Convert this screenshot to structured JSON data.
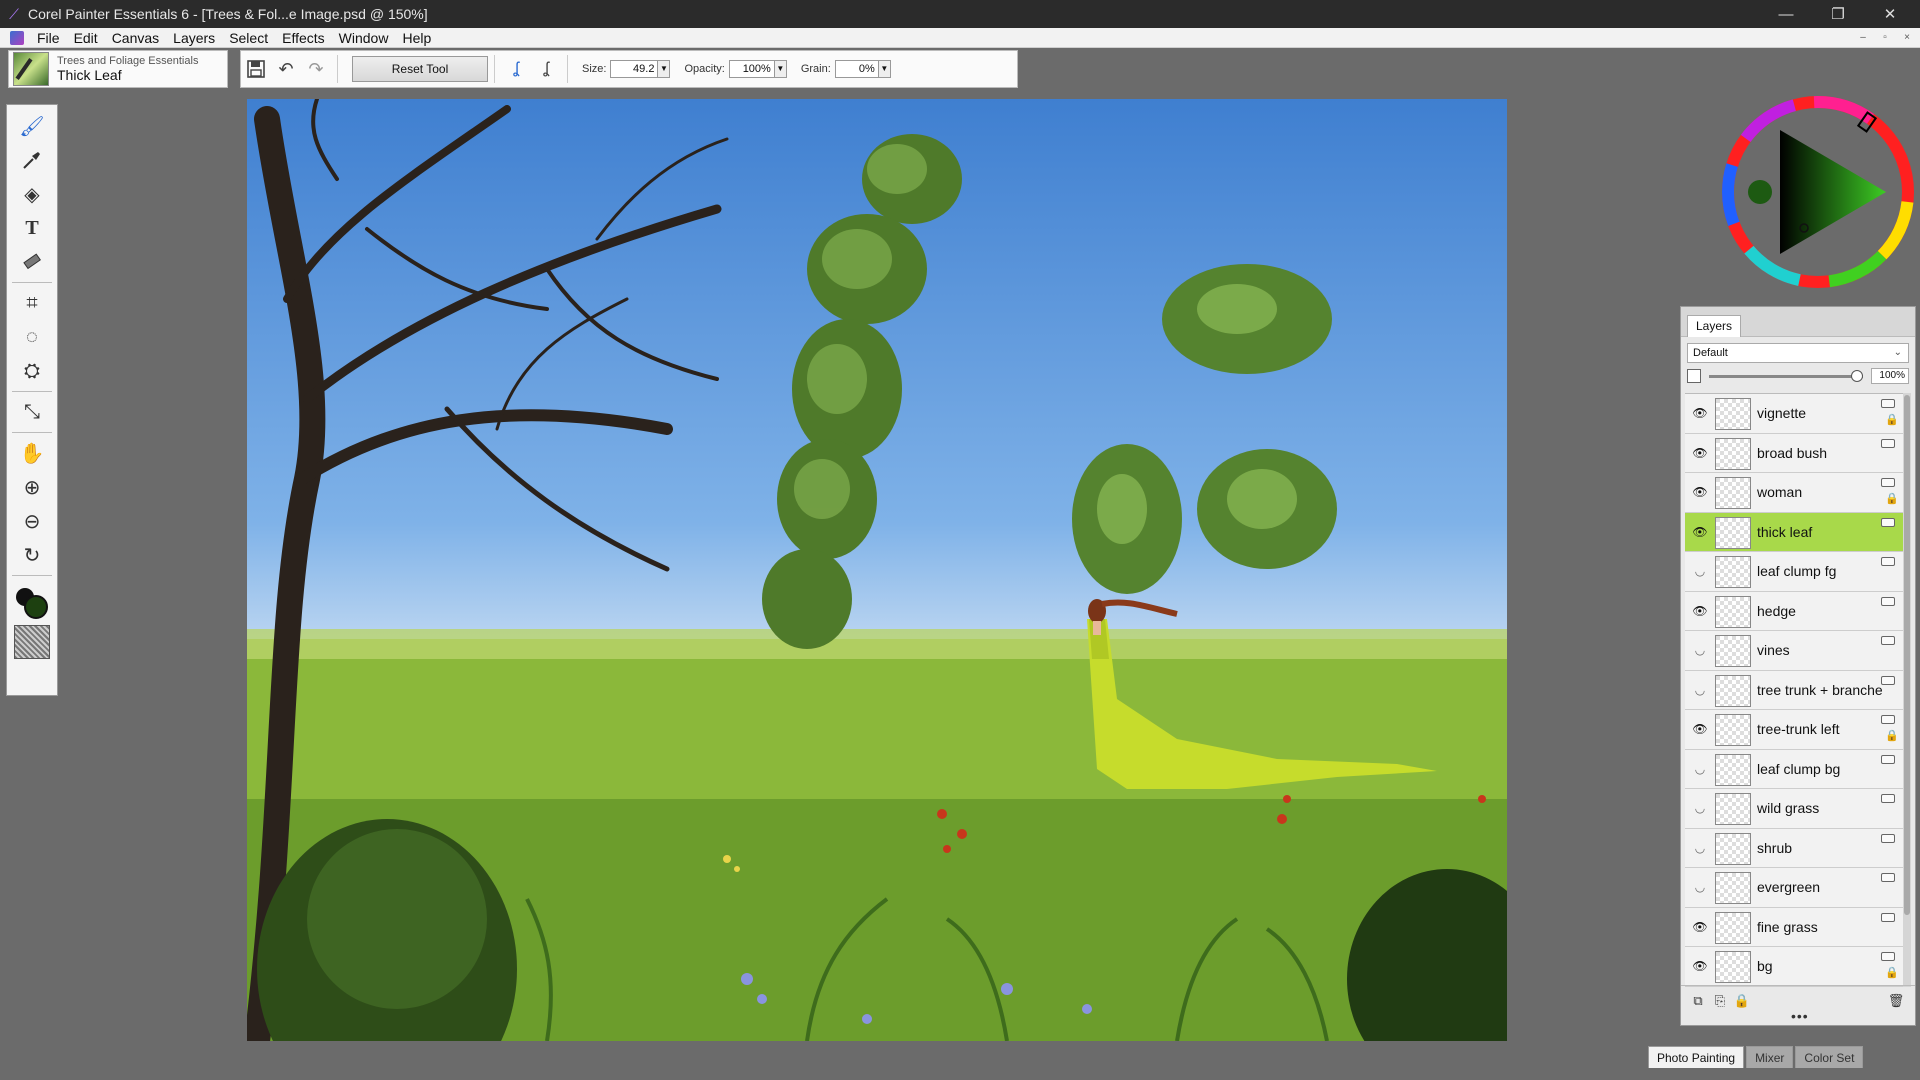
{
  "window": {
    "title": "Corel Painter Essentials 6 - [Trees & Fol...e Image.psd @ 150%]",
    "controls": {
      "minimize": "—",
      "restore": "❐",
      "close": "✕"
    }
  },
  "menu": [
    "File",
    "Edit",
    "Canvas",
    "Layers",
    "Select",
    "Effects",
    "Window",
    "Help"
  ],
  "brush": {
    "category": "Trees and Foliage Essentials",
    "variant": "Thick Leaf"
  },
  "property_bar": {
    "reset_label": "Reset Tool",
    "size_label": "Size:",
    "size_value": "49.2",
    "opacity_label": "Opacity:",
    "opacity_value": "100%",
    "grain_label": "Grain:",
    "grain_value": "0%"
  },
  "toolbox": {
    "tools": [
      "brush-tool",
      "dropper-tool",
      "paint-bucket-tool",
      "text-tool",
      "eraser-tool",
      "crop-tool",
      "lasso-tool",
      "stamp-tool",
      "layer-adjuster-tool",
      "grabber-tool",
      "zoom-in-tool",
      "zoom-out-tool",
      "rotate-page-tool"
    ],
    "main_color": "#1d4010",
    "additional_color": "#111111"
  },
  "color_wheel": {
    "selected_hue": "#3dcc24",
    "selected_color": "#1d5a12"
  },
  "layers": {
    "tab_label": "Layers",
    "composite_method": "Default",
    "opacity": "100%",
    "opacity_value": 1.0,
    "items": [
      {
        "name": "vignette",
        "visible": true,
        "locked": true,
        "selected": false
      },
      {
        "name": "broad bush",
        "visible": true,
        "locked": false,
        "selected": false
      },
      {
        "name": "woman",
        "visible": true,
        "locked": true,
        "selected": false
      },
      {
        "name": "thick leaf",
        "visible": true,
        "locked": false,
        "selected": true
      },
      {
        "name": "leaf clump fg",
        "visible": false,
        "locked": false,
        "selected": false
      },
      {
        "name": "hedge",
        "visible": true,
        "locked": false,
        "selected": false
      },
      {
        "name": "vines",
        "visible": false,
        "locked": false,
        "selected": false
      },
      {
        "name": "tree trunk + branche",
        "visible": false,
        "locked": false,
        "selected": false
      },
      {
        "name": "tree-trunk left",
        "visible": true,
        "locked": true,
        "selected": false
      },
      {
        "name": "leaf clump bg",
        "visible": false,
        "locked": false,
        "selected": false
      },
      {
        "name": "wild grass",
        "visible": false,
        "locked": false,
        "selected": false
      },
      {
        "name": "shrub",
        "visible": false,
        "locked": false,
        "selected": false
      },
      {
        "name": "evergreen",
        "visible": false,
        "locked": false,
        "selected": false
      },
      {
        "name": "fine grass",
        "visible": true,
        "locked": false,
        "selected": false
      },
      {
        "name": "bg",
        "visible": true,
        "locked": true,
        "selected": false
      }
    ]
  },
  "bottom_panel_tabs": [
    {
      "label": "Photo Painting",
      "active": true
    },
    {
      "label": "Mixer",
      "active": false
    },
    {
      "label": "Color Set",
      "active": false
    }
  ]
}
